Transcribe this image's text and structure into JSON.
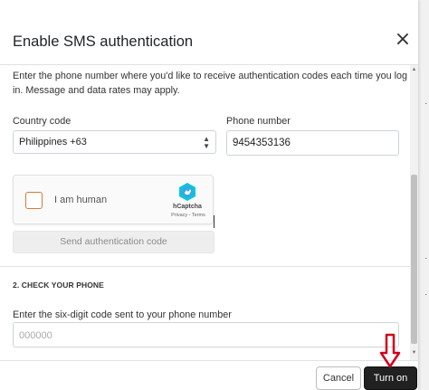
{
  "modal": {
    "title": "Enable SMS authentication",
    "close_icon": "close-icon",
    "intro": "Enter the phone number where you'd like to receive authentication codes each time you log in. Message and data rates may apply."
  },
  "form": {
    "country_code_label": "Country code",
    "country_code_value": "Philippines +63",
    "phone_label": "Phone number",
    "phone_value": "9454353136",
    "captcha": {
      "label": "I am human",
      "brand": "hCaptcha",
      "links": "Privacy - Terms",
      "checkbox_color": "#d77a3a"
    },
    "send_code_label": "Send authentication code"
  },
  "check_phone": {
    "section_title": "2. CHECK YOUR PHONE",
    "code_label": "Enter the six-digit code sent to your phone number",
    "code_placeholder": "000000"
  },
  "footer": {
    "cancel_label": "Cancel",
    "turn_on_label": "Turn on"
  },
  "annotation": {
    "arrow_icon": "down-arrow-icon",
    "arrow_color": "#d0021b"
  },
  "colors": {
    "primary_button": "#212121",
    "border": "#ced4da"
  }
}
